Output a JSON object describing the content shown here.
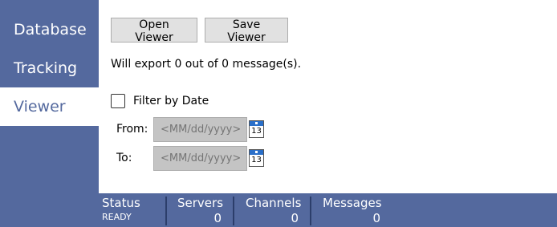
{
  "sidebar": {
    "items": [
      {
        "label": "Database"
      },
      {
        "label": "Tracking"
      },
      {
        "label": "Viewer",
        "active": true
      }
    ]
  },
  "toolbar": {
    "open_label": "Open Viewer",
    "save_label": "Save Viewer"
  },
  "export_status": "Will export 0 out of 0 message(s).",
  "filter": {
    "checkbox_label": "Filter by Date",
    "checked": false,
    "from_label": "From:",
    "to_label": "To:",
    "from_placeholder": "<MM/dd/yyyy>",
    "to_placeholder": "<MM/dd/yyyy>",
    "calendar_icon": "calendar-icon",
    "calendar_day": "13"
  },
  "statusbar": {
    "status_title": "Status",
    "status_value": "READY",
    "servers_title": "Servers",
    "servers_value": "0",
    "channels_title": "Channels",
    "channels_value": "0",
    "messages_title": "Messages",
    "messages_value": "0"
  },
  "colors": {
    "accent": "#54699e",
    "status_separator": "#2c3e6b",
    "calendar_header": "#2a6fc9"
  }
}
